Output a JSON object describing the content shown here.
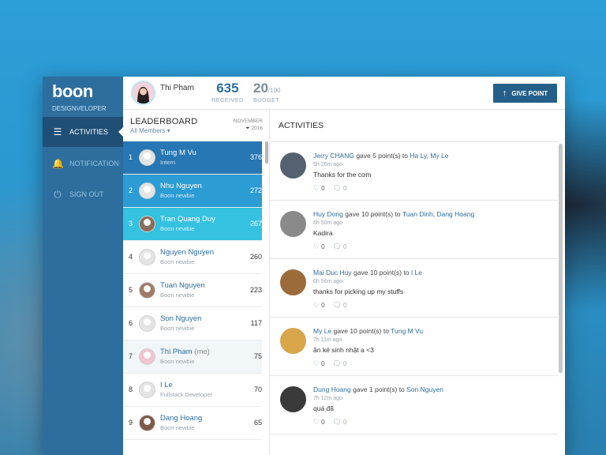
{
  "sidebar": {
    "logo": "boon",
    "org": "DESIGNVELOPER",
    "items": [
      {
        "label": "ACTIVITIES",
        "icon": "menu-icon",
        "active": true
      },
      {
        "label": "NOTIFICATION",
        "icon": "bell-icon",
        "active": false
      },
      {
        "label": "SIGN OUT",
        "icon": "power-icon",
        "active": false
      }
    ]
  },
  "header": {
    "user_name": "Thi Pham",
    "received_value": "635",
    "received_label": "RECEIVED",
    "budget_value": "20",
    "budget_max": "/100",
    "budget_label": "BUDGET",
    "give_button": "GIVE POINT",
    "give_icon": "arrow-up-icon"
  },
  "leaderboard": {
    "title": "LEADERBOARD",
    "filter": "All Members ▾",
    "month": "NOVEMBER",
    "year": "2016",
    "rows": [
      {
        "rank": "1",
        "name": "Tung M Vu",
        "sub": "Intern",
        "points": "376"
      },
      {
        "rank": "2",
        "name": "Nhu Nguyen",
        "sub": "Boon newbie",
        "points": "272"
      },
      {
        "rank": "3",
        "name": "Tran Quang Duy",
        "sub": "Boon newbie",
        "points": "267"
      },
      {
        "rank": "4",
        "name": "Nguyen Nguyen",
        "sub": "Boon newbie",
        "points": "260"
      },
      {
        "rank": "5",
        "name": "Tuan Nguyen",
        "sub": "Boon newbie",
        "points": "223"
      },
      {
        "rank": "6",
        "name": "Son Nguyen",
        "sub": "Boon newbie",
        "points": "117"
      },
      {
        "rank": "7",
        "name": "Thi Pham",
        "me": "(me)",
        "sub": "Boon newbie",
        "points": "75"
      },
      {
        "rank": "8",
        "name": "I Le",
        "sub": "Fullstack Developer",
        "points": "70"
      },
      {
        "rank": "9",
        "name": "Dang Hoang",
        "sub": "Boon newbie",
        "points": "65"
      }
    ]
  },
  "activities": {
    "title": "ACTIVITIES",
    "items": [
      {
        "giver": "Jerry CHANG",
        "verb": "gave 5 point(s) to",
        "recipients": [
          "Ha Ly",
          "My Le"
        ],
        "time": "5h 26m ago",
        "message": "Thanks for the cơm",
        "likes": "0",
        "comments": "0",
        "avatar_color": "#556070"
      },
      {
        "giver": "Huy Dong",
        "verb": "gave 10 point(s) to",
        "recipients": [
          "Tuan Dinh",
          "Dang Hoang"
        ],
        "time": "6h 50m ago",
        "message": "Kadira",
        "likes": "0",
        "comments": "0",
        "avatar_color": "#8a8a8a"
      },
      {
        "giver": "Mai Duc Huy",
        "verb": "gave 10 point(s) to",
        "recipients": [
          "I Le"
        ],
        "time": "6h 56m ago",
        "message": "thanks for picking up my stuffs",
        "likes": "0",
        "comments": "0",
        "avatar_color": "#9b6b3a"
      },
      {
        "giver": "My Le",
        "verb": "gave 10 point(s) to",
        "recipients": [
          "Tung M Vu"
        ],
        "time": "7h 11m ago",
        "message": "ăn ké sinh nhật a <3",
        "likes": "0",
        "comments": "0",
        "avatar_color": "#d9a54a"
      },
      {
        "giver": "Dung Hoang",
        "verb": "gave 1 point(s) to",
        "recipients": [
          "Son Nguyen"
        ],
        "time": "7h 12m ago",
        "message": "quá đã",
        "likes": "0",
        "comments": "0",
        "avatar_color": "#3a3a3a"
      }
    ]
  }
}
